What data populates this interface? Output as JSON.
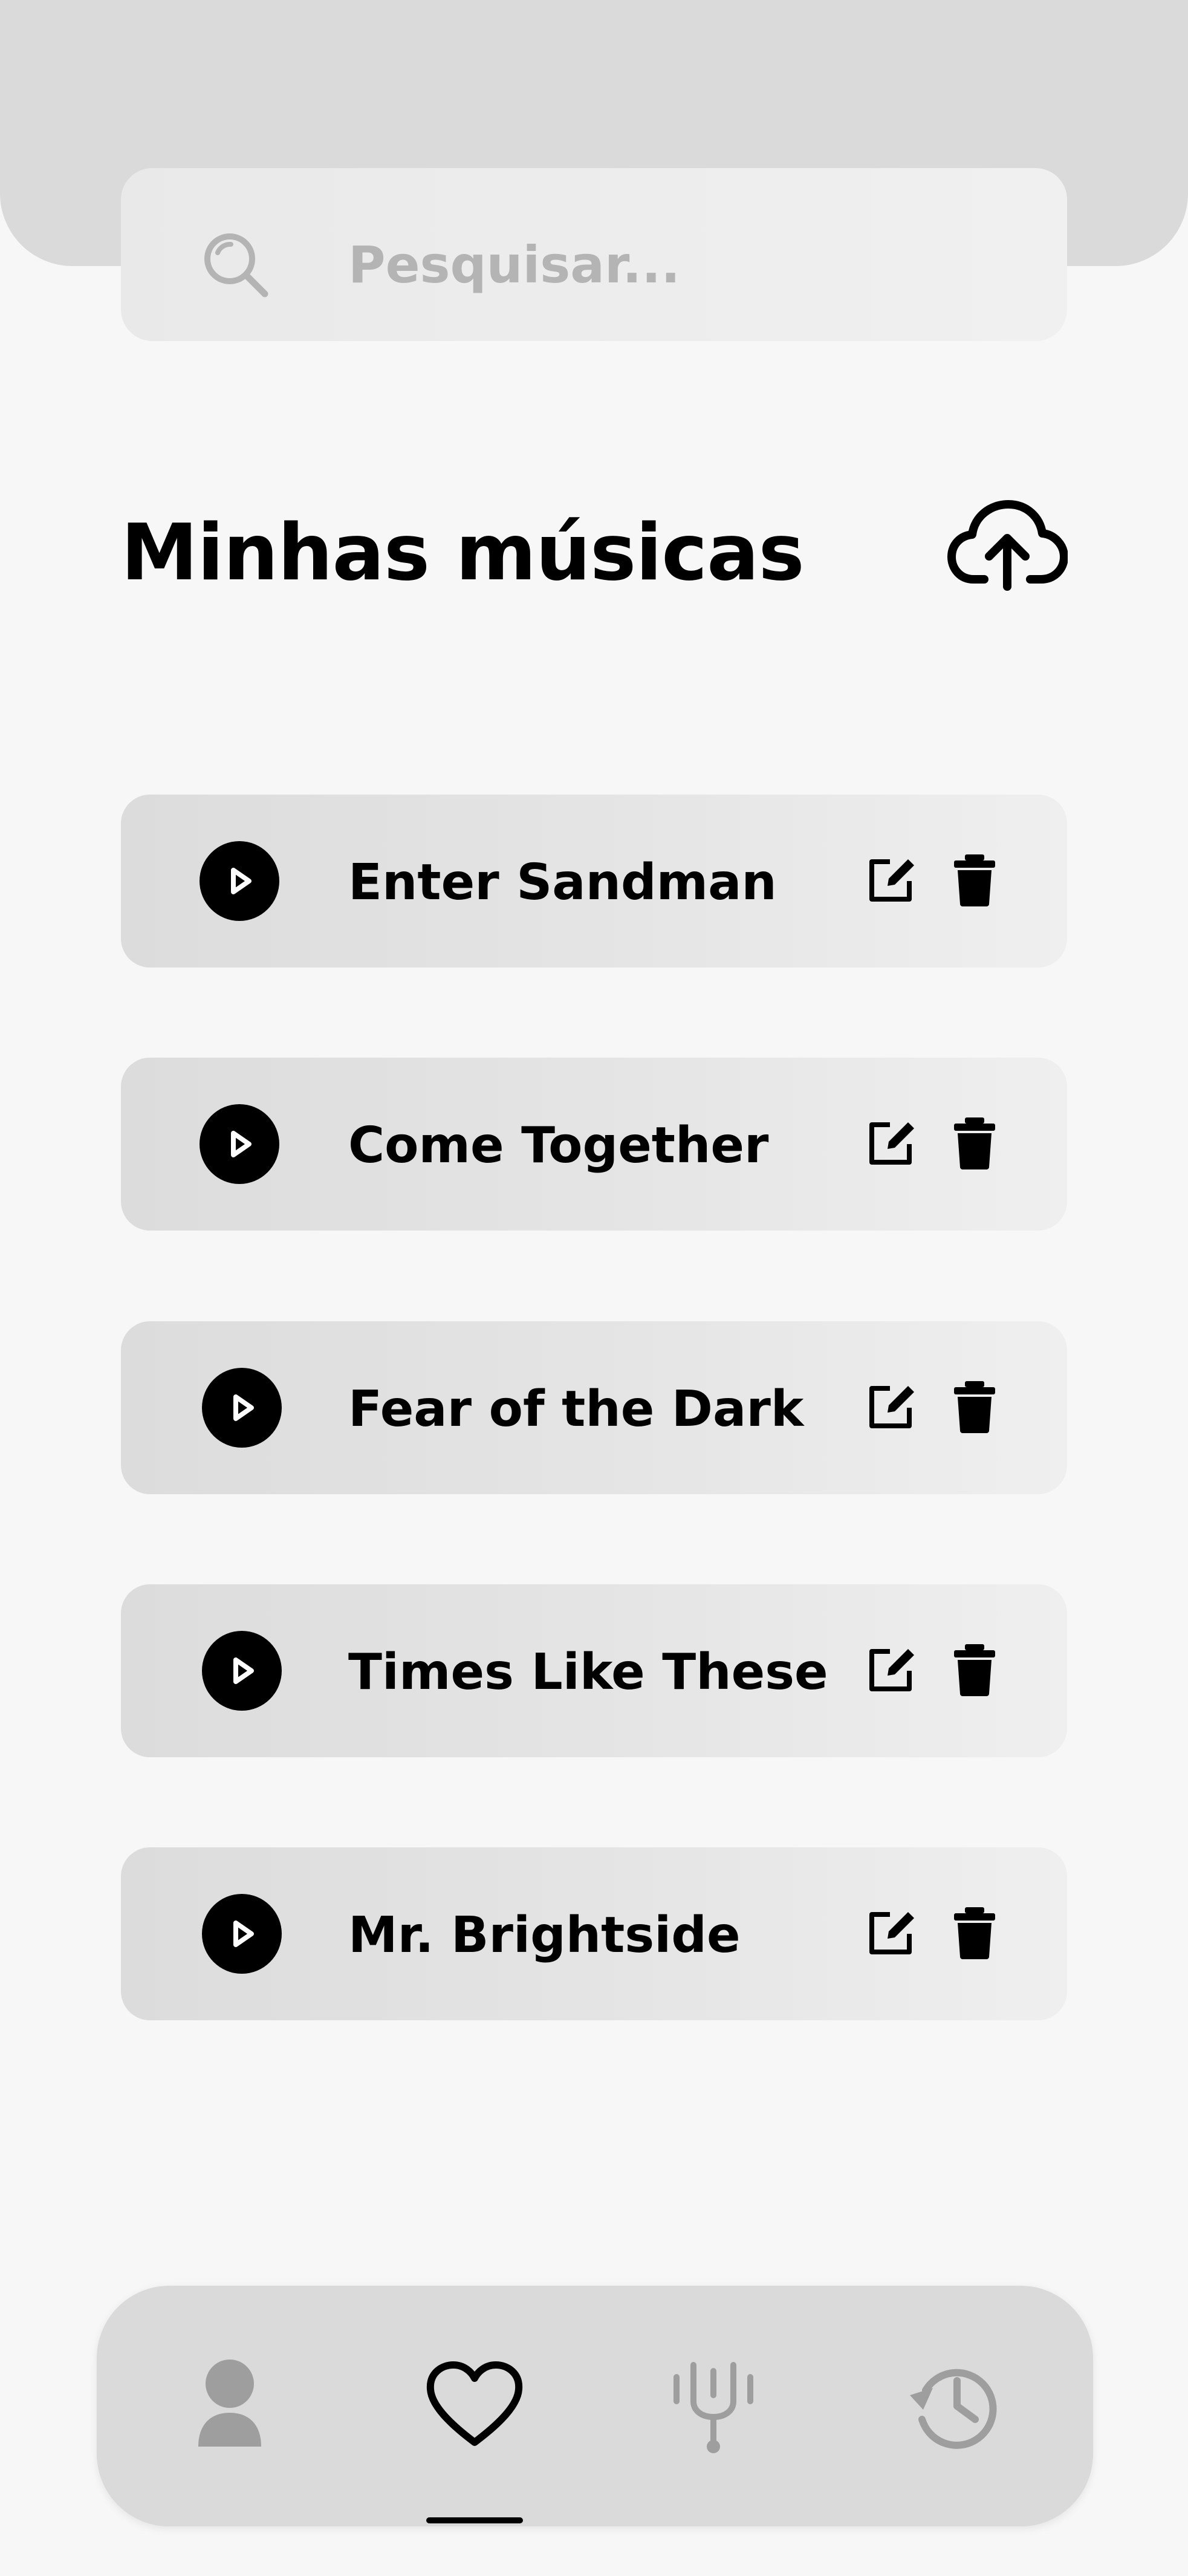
{
  "search": {
    "placeholder": "Pesquisar..."
  },
  "page": {
    "title": "Minhas músicas"
  },
  "songs": [
    {
      "title": "Enter Sandman"
    },
    {
      "title": "Come Together"
    },
    {
      "title": "Fear of the Dark"
    },
    {
      "title": "Times Like These"
    },
    {
      "title": "Mr. Brightside"
    }
  ],
  "icons": {
    "search": "search-icon",
    "upload": "cloud-upload-icon",
    "play": "play-icon",
    "edit": "edit-icon",
    "delete": "trash-icon",
    "nav_profile": "user-icon",
    "nav_favorites": "heart-icon",
    "nav_tuner": "tuning-fork-icon",
    "nav_history": "history-icon"
  },
  "nav": {
    "active_item": "favorites"
  },
  "colors": {
    "background": "#F7F7F7",
    "header": "#DADADA",
    "text": "#000000",
    "placeholder": "#B4B4B4",
    "inactive_icon": "#9E9E9E"
  }
}
